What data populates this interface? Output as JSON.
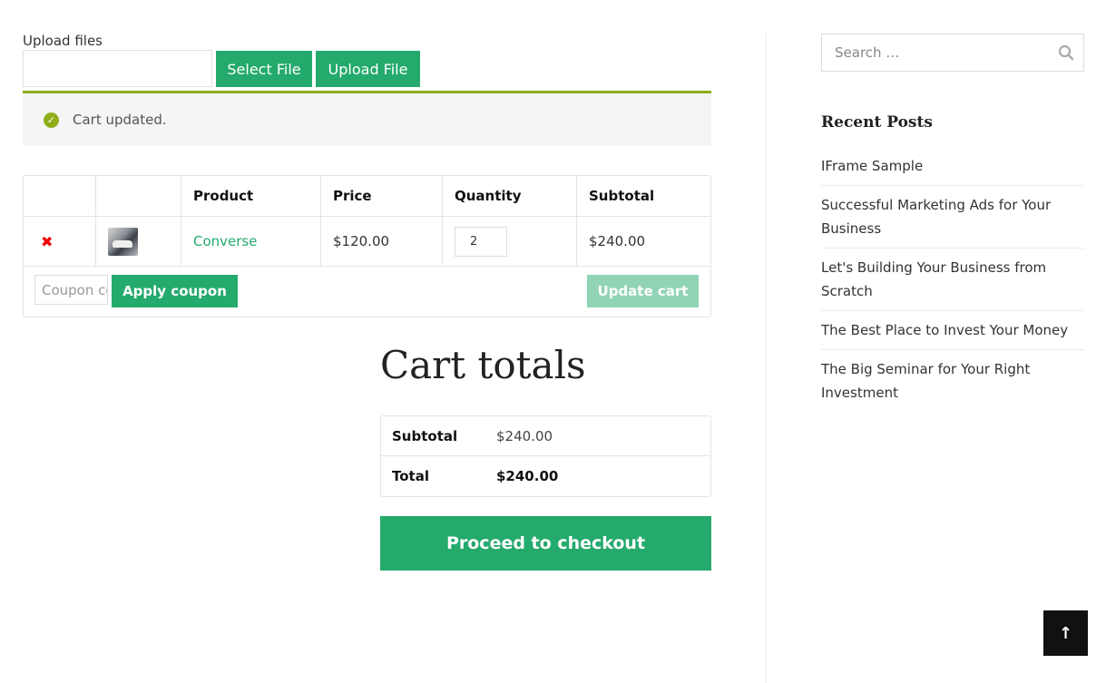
{
  "upload": {
    "label": "Upload files",
    "select_button": "Select File",
    "upload_button": "Upload File"
  },
  "notice": {
    "message": "Cart updated.",
    "icon": "check-circle-icon",
    "accent_color": "#8fae1b"
  },
  "cart": {
    "headers": [
      "",
      "",
      "Product",
      "Price",
      "Quantity",
      "Subtotal"
    ],
    "items": [
      {
        "product": "Converse",
        "price": "$120.00",
        "quantity": "2",
        "subtotal": "$240.00"
      }
    ],
    "coupon_placeholder": "Coupon code",
    "apply_coupon_label": "Apply coupon",
    "update_cart_label": "Update cart"
  },
  "totals": {
    "title": "Cart totals",
    "subtotal_label": "Subtotal",
    "subtotal_value": "$240.00",
    "total_label": "Total",
    "total_value": "$240.00",
    "checkout_label": "Proceed to checkout"
  },
  "sidebar": {
    "search_placeholder": "Search …",
    "recent_posts_title": "Recent Posts",
    "recent_posts": [
      "IFrame Sample",
      "Successful Marketing Ads for Your Business",
      "Let's Building Your Business from Scratch",
      "The Best Place to Invest Your Money",
      "The Big Seminar for Your Right Investment"
    ]
  },
  "colors": {
    "brand_green": "#24aa6c",
    "disabled_green": "#91d4b5",
    "remove_red": "#ee0000"
  }
}
